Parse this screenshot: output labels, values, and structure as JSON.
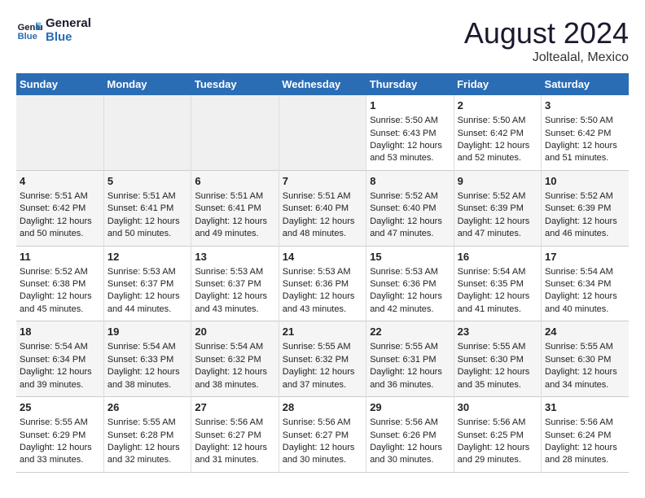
{
  "header": {
    "logo_line1": "General",
    "logo_line2": "Blue",
    "title": "August 2024",
    "subtitle": "Joltealal, Mexico"
  },
  "days_of_week": [
    "Sunday",
    "Monday",
    "Tuesday",
    "Wednesday",
    "Thursday",
    "Friday",
    "Saturday"
  ],
  "weeks": [
    [
      {
        "day": "",
        "empty": true
      },
      {
        "day": "",
        "empty": true
      },
      {
        "day": "",
        "empty": true
      },
      {
        "day": "",
        "empty": true
      },
      {
        "day": "1",
        "sunrise": "5:50 AM",
        "sunset": "6:43 PM",
        "daylight": "12 hours and 53 minutes."
      },
      {
        "day": "2",
        "sunrise": "5:50 AM",
        "sunset": "6:42 PM",
        "daylight": "12 hours and 52 minutes."
      },
      {
        "day": "3",
        "sunrise": "5:50 AM",
        "sunset": "6:42 PM",
        "daylight": "12 hours and 51 minutes."
      }
    ],
    [
      {
        "day": "4",
        "sunrise": "5:51 AM",
        "sunset": "6:42 PM",
        "daylight": "12 hours and 50 minutes."
      },
      {
        "day": "5",
        "sunrise": "5:51 AM",
        "sunset": "6:41 PM",
        "daylight": "12 hours and 50 minutes."
      },
      {
        "day": "6",
        "sunrise": "5:51 AM",
        "sunset": "6:41 PM",
        "daylight": "12 hours and 49 minutes."
      },
      {
        "day": "7",
        "sunrise": "5:51 AM",
        "sunset": "6:40 PM",
        "daylight": "12 hours and 48 minutes."
      },
      {
        "day": "8",
        "sunrise": "5:52 AM",
        "sunset": "6:40 PM",
        "daylight": "12 hours and 47 minutes."
      },
      {
        "day": "9",
        "sunrise": "5:52 AM",
        "sunset": "6:39 PM",
        "daylight": "12 hours and 47 minutes."
      },
      {
        "day": "10",
        "sunrise": "5:52 AM",
        "sunset": "6:39 PM",
        "daylight": "12 hours and 46 minutes."
      }
    ],
    [
      {
        "day": "11",
        "sunrise": "5:52 AM",
        "sunset": "6:38 PM",
        "daylight": "12 hours and 45 minutes."
      },
      {
        "day": "12",
        "sunrise": "5:53 AM",
        "sunset": "6:37 PM",
        "daylight": "12 hours and 44 minutes."
      },
      {
        "day": "13",
        "sunrise": "5:53 AM",
        "sunset": "6:37 PM",
        "daylight": "12 hours and 43 minutes."
      },
      {
        "day": "14",
        "sunrise": "5:53 AM",
        "sunset": "6:36 PM",
        "daylight": "12 hours and 43 minutes."
      },
      {
        "day": "15",
        "sunrise": "5:53 AM",
        "sunset": "6:36 PM",
        "daylight": "12 hours and 42 minutes."
      },
      {
        "day": "16",
        "sunrise": "5:54 AM",
        "sunset": "6:35 PM",
        "daylight": "12 hours and 41 minutes."
      },
      {
        "day": "17",
        "sunrise": "5:54 AM",
        "sunset": "6:34 PM",
        "daylight": "12 hours and 40 minutes."
      }
    ],
    [
      {
        "day": "18",
        "sunrise": "5:54 AM",
        "sunset": "6:34 PM",
        "daylight": "12 hours and 39 minutes."
      },
      {
        "day": "19",
        "sunrise": "5:54 AM",
        "sunset": "6:33 PM",
        "daylight": "12 hours and 38 minutes."
      },
      {
        "day": "20",
        "sunrise": "5:54 AM",
        "sunset": "6:32 PM",
        "daylight": "12 hours and 38 minutes."
      },
      {
        "day": "21",
        "sunrise": "5:55 AM",
        "sunset": "6:32 PM",
        "daylight": "12 hours and 37 minutes."
      },
      {
        "day": "22",
        "sunrise": "5:55 AM",
        "sunset": "6:31 PM",
        "daylight": "12 hours and 36 minutes."
      },
      {
        "day": "23",
        "sunrise": "5:55 AM",
        "sunset": "6:30 PM",
        "daylight": "12 hours and 35 minutes."
      },
      {
        "day": "24",
        "sunrise": "5:55 AM",
        "sunset": "6:30 PM",
        "daylight": "12 hours and 34 minutes."
      }
    ],
    [
      {
        "day": "25",
        "sunrise": "5:55 AM",
        "sunset": "6:29 PM",
        "daylight": "12 hours and 33 minutes."
      },
      {
        "day": "26",
        "sunrise": "5:55 AM",
        "sunset": "6:28 PM",
        "daylight": "12 hours and 32 minutes."
      },
      {
        "day": "27",
        "sunrise": "5:56 AM",
        "sunset": "6:27 PM",
        "daylight": "12 hours and 31 minutes."
      },
      {
        "day": "28",
        "sunrise": "5:56 AM",
        "sunset": "6:27 PM",
        "daylight": "12 hours and 30 minutes."
      },
      {
        "day": "29",
        "sunrise": "5:56 AM",
        "sunset": "6:26 PM",
        "daylight": "12 hours and 30 minutes."
      },
      {
        "day": "30",
        "sunrise": "5:56 AM",
        "sunset": "6:25 PM",
        "daylight": "12 hours and 29 minutes."
      },
      {
        "day": "31",
        "sunrise": "5:56 AM",
        "sunset": "6:24 PM",
        "daylight": "12 hours and 28 minutes."
      }
    ]
  ]
}
